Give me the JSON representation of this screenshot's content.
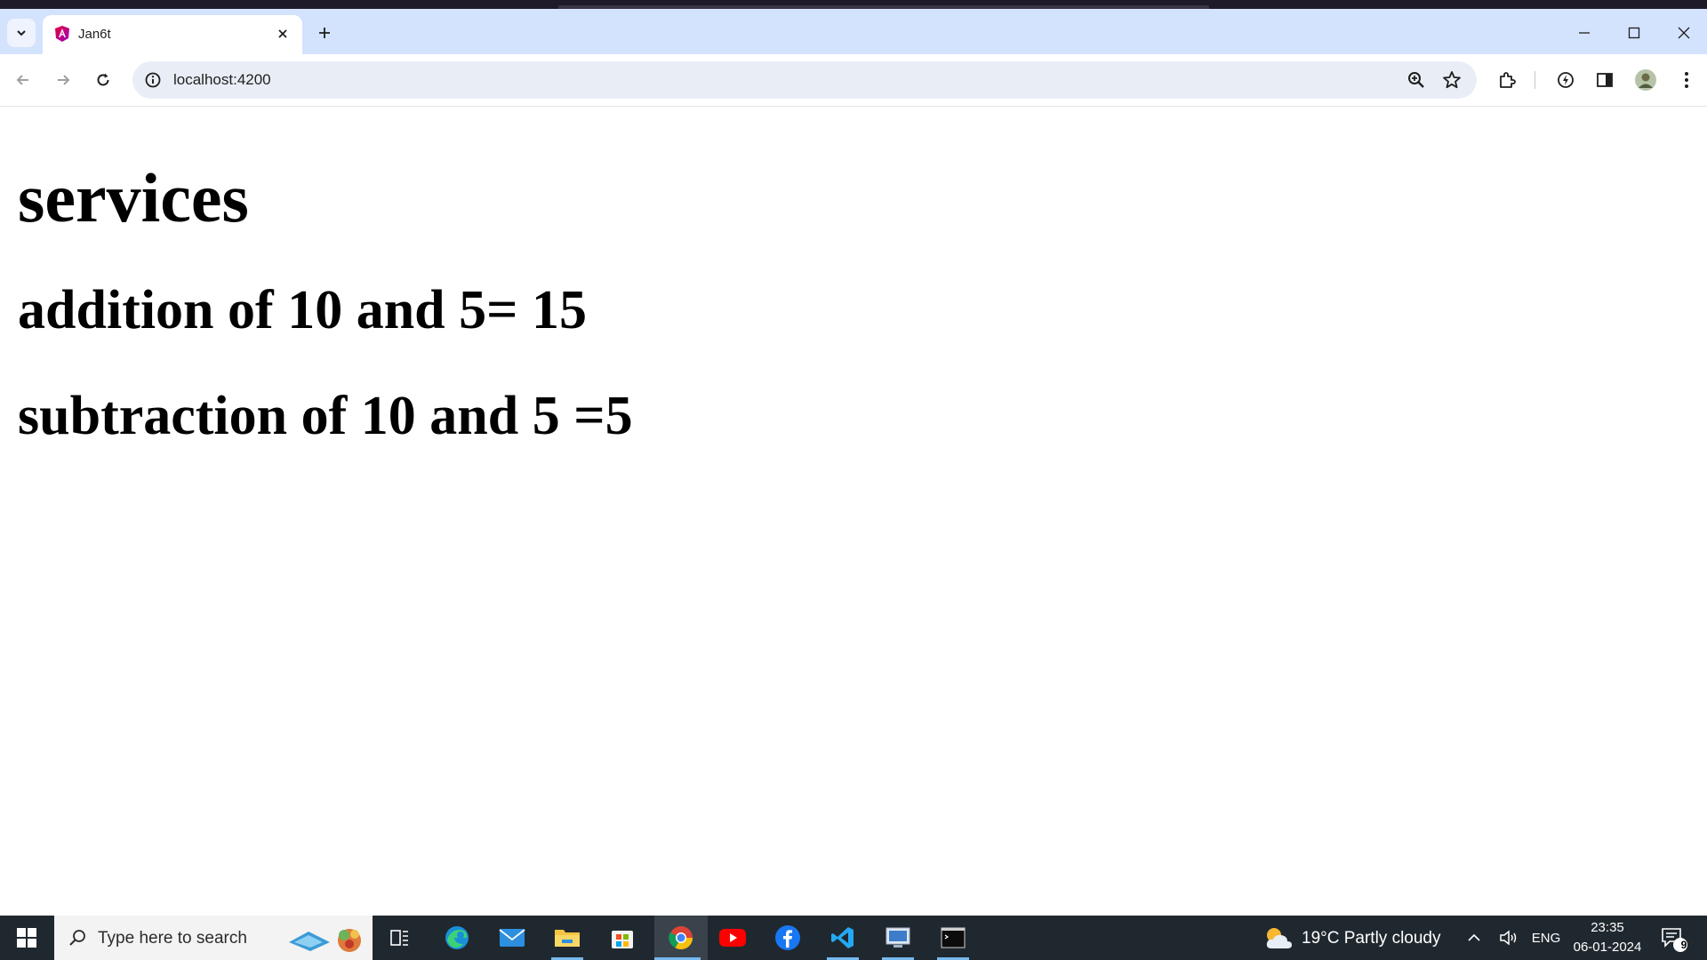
{
  "browser": {
    "tab": {
      "title": "Jan6t"
    },
    "address_bar": {
      "url": "localhost:4200"
    }
  },
  "page": {
    "heading": "services",
    "lines": [
      "addition of 10 and 5= 15",
      "subtraction of 10 and 5 =5"
    ]
  },
  "taskbar": {
    "search_placeholder": "Type here to search",
    "weather": "19°C  Partly cloudy",
    "language": "ENG",
    "time": "23:35",
    "date": "06-01-2024",
    "notification_count": "9",
    "apps": [
      "task-view",
      "edge",
      "mail",
      "file-explorer",
      "microsoft-store",
      "chrome",
      "youtube",
      "facebook",
      "vscode",
      "remote-desktop",
      "terminal"
    ]
  },
  "colors": {
    "tab_strip": "#d3e3fd",
    "omnibox": "#e9eef6",
    "taskbar": "#20282f"
  }
}
